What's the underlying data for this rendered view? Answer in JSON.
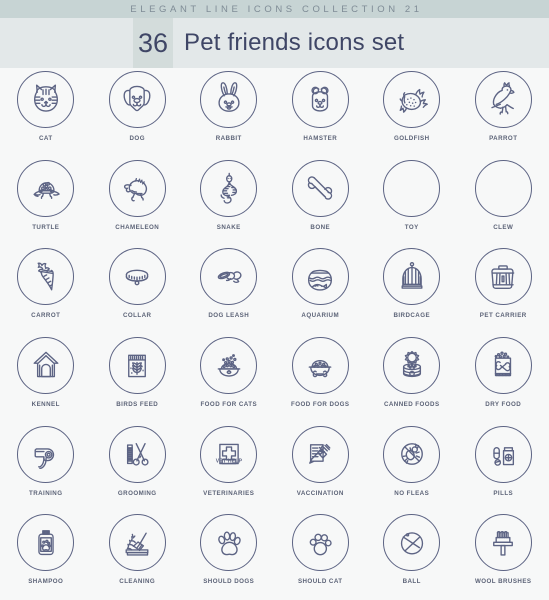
{
  "header": {
    "kicker": "ELEGANT LINE ICONS COLLECTION 21",
    "count": "36",
    "title": "Pet friends icons set"
  },
  "colors": {
    "top_band": "#c7d4d4",
    "title_band": "#e3e8e9",
    "count_block": "#d3dcdb",
    "ink": "#5d6484",
    "title_ink": "#3f4666",
    "page_bg": "#f7f8f8"
  },
  "icons": [
    {
      "id": "cat",
      "label": "CAT",
      "icon": "cat-icon"
    },
    {
      "id": "dog",
      "label": "DOG",
      "icon": "dog-icon"
    },
    {
      "id": "rabbit",
      "label": "RABBIT",
      "icon": "rabbit-icon"
    },
    {
      "id": "hamster",
      "label": "HAMSTER",
      "icon": "hamster-icon"
    },
    {
      "id": "goldfish",
      "label": "GOLDFISH",
      "icon": "goldfish-icon"
    },
    {
      "id": "parrot",
      "label": "PARROT",
      "icon": "parrot-icon"
    },
    {
      "id": "turtle",
      "label": "TURTLE",
      "icon": "turtle-icon"
    },
    {
      "id": "chameleon",
      "label": "CHAMELEON",
      "icon": "chameleon-icon"
    },
    {
      "id": "snake",
      "label": "SNAKE",
      "icon": "snake-icon"
    },
    {
      "id": "bone",
      "label": "BONE",
      "icon": "bone-icon"
    },
    {
      "id": "toy",
      "label": "TOY",
      "icon": "wind-up-mouse-toy-icon"
    },
    {
      "id": "clew",
      "label": "CLEW",
      "icon": "yarn-ball-icon"
    },
    {
      "id": "carrot",
      "label": "CARROT",
      "icon": "carrot-icon"
    },
    {
      "id": "collar",
      "label": "COLLAR",
      "icon": "collar-icon"
    },
    {
      "id": "dog-leash",
      "label": "DOG LEASH",
      "icon": "dog-leash-icon"
    },
    {
      "id": "aquarium",
      "label": "AQUARIUM",
      "icon": "aquarium-icon"
    },
    {
      "id": "birdcage",
      "label": "BIRDCAGE",
      "icon": "birdcage-icon"
    },
    {
      "id": "pet-carrier",
      "label": "PET CARRIER",
      "icon": "pet-carrier-icon"
    },
    {
      "id": "kennel",
      "label": "KENNEL",
      "icon": "kennel-icon"
    },
    {
      "id": "birds-feed",
      "label": "BIRDS FEED",
      "icon": "birds-feed-icon"
    },
    {
      "id": "food-cats",
      "label": "FOOD FOR CATS",
      "icon": "cat-food-bowl-icon"
    },
    {
      "id": "food-dogs",
      "label": "FOOD FOR DOGS",
      "icon": "dog-food-bowl-icon"
    },
    {
      "id": "canned-foods",
      "label": "CANNED FOODS",
      "icon": "canned-food-icon"
    },
    {
      "id": "dry-food",
      "label": "DRY FOOD",
      "icon": "dry-food-bag-icon"
    },
    {
      "id": "training",
      "label": "TRAINING",
      "icon": "whistle-icon"
    },
    {
      "id": "grooming",
      "label": "GROOMING",
      "icon": "comb-scissors-icon"
    },
    {
      "id": "veterinaries",
      "label": "VETERINARIES",
      "icon": "vet-help-sign-icon",
      "sign_text": "VET HELP"
    },
    {
      "id": "vaccination",
      "label": "VACCINATION",
      "icon": "syringe-checklist-icon"
    },
    {
      "id": "no-fleas",
      "label": "NO FLEAS",
      "icon": "no-fleas-icon"
    },
    {
      "id": "pills",
      "label": "PILLS",
      "icon": "pills-bottle-icon"
    },
    {
      "id": "shampoo",
      "label": "SHAMPOO",
      "icon": "shampoo-bottle-icon"
    },
    {
      "id": "cleaning",
      "label": "CLEANING",
      "icon": "broom-dustpan-icon"
    },
    {
      "id": "should-dogs",
      "label": "SHOULD DOGS",
      "icon": "dog-paw-print-icon"
    },
    {
      "id": "should-cat",
      "label": "SHOULD CAT",
      "icon": "cat-paw-print-icon"
    },
    {
      "id": "ball",
      "label": "BALL",
      "icon": "ball-icon"
    },
    {
      "id": "wool-brushes",
      "label": "WOOL BRUSHES",
      "icon": "wool-brush-icon"
    }
  ]
}
